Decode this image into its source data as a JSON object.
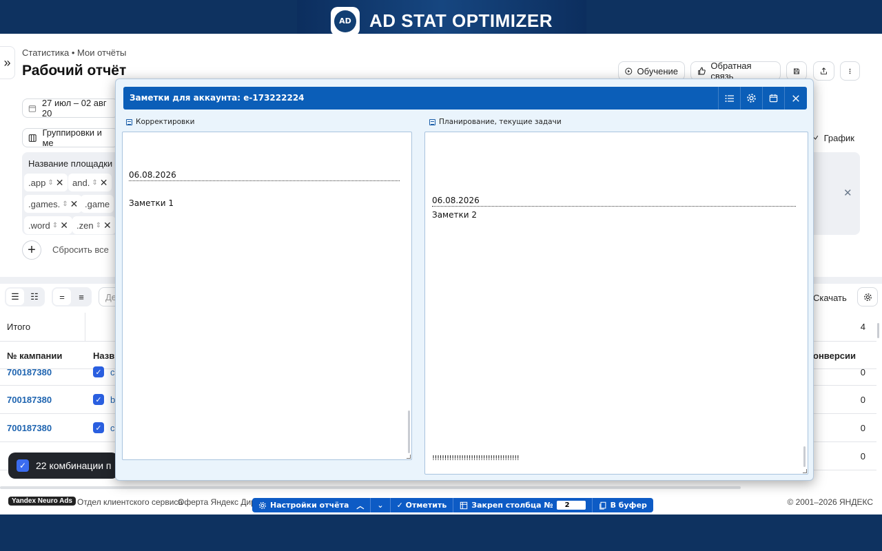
{
  "banner": {
    "logo_text": "AD",
    "title": "AD STAT OPTIMIZER"
  },
  "page": {
    "breadcrumb": "Статистика • Мои отчёты",
    "title": "Рабочий отчёт",
    "buttons": {
      "training": "Обучение",
      "feedback": "Обратная связь"
    }
  },
  "toolbar": {
    "date_range": "27 июл – 02 авг 20",
    "groupings": "Группировки и ме",
    "chart": "График",
    "download": "Скачать",
    "search_placeholder": "Де"
  },
  "filters": {
    "title": "Название площадки",
    "tags": [
      ".app",
      "and.",
      ".games.",
      ".game",
      ".word",
      ".zen"
    ],
    "reset": "Сбросить все"
  },
  "table": {
    "total_label": "Итого",
    "total_value": "4",
    "headers": {
      "campaign": "№ кампании",
      "name": "Назв",
      "conversions": "онверсии"
    },
    "rows": [
      {
        "id": "700187380",
        "name": "c",
        "value": "0"
      },
      {
        "id": "700187380",
        "name": "b",
        "value": "0"
      },
      {
        "id": "700187380",
        "name": "c",
        "value": "0"
      },
      {
        "id": "",
        "name": "",
        "value": "0"
      }
    ],
    "selection_text": "22 комбинации п"
  },
  "footer": {
    "yandex_badge": "Yandex Neuro Ads",
    "client_service": "Отдел клиентского сервиса",
    "offer": "Оферта Яндекс Дире",
    "copyright": "© 2001–2026 ЯНДЕКС"
  },
  "ext_toolbar": {
    "settings": "Настройки отчёта",
    "mark": "✓ Отметить",
    "pin_column": "Закреп столбца №",
    "pin_value": "2",
    "to_buffer": "В буфер"
  },
  "modal": {
    "title": "Заметки для аккаунта: e-173222224",
    "left_label": "Корректировки",
    "right_label": "Планирование, текущие задачи",
    "left_date": "06.08.2026",
    "left_note": "Заметки 1",
    "right_date": "06.08.2026",
    "right_note": "Заметки 2",
    "right_excl": "!!!!!!!!!!!!!!!!!!!!!!!!!!!!!!!!!!!!"
  },
  "colors": {
    "modal_header": "#0b5eb8",
    "background": "#0e3260",
    "link": "#1e64b0"
  }
}
